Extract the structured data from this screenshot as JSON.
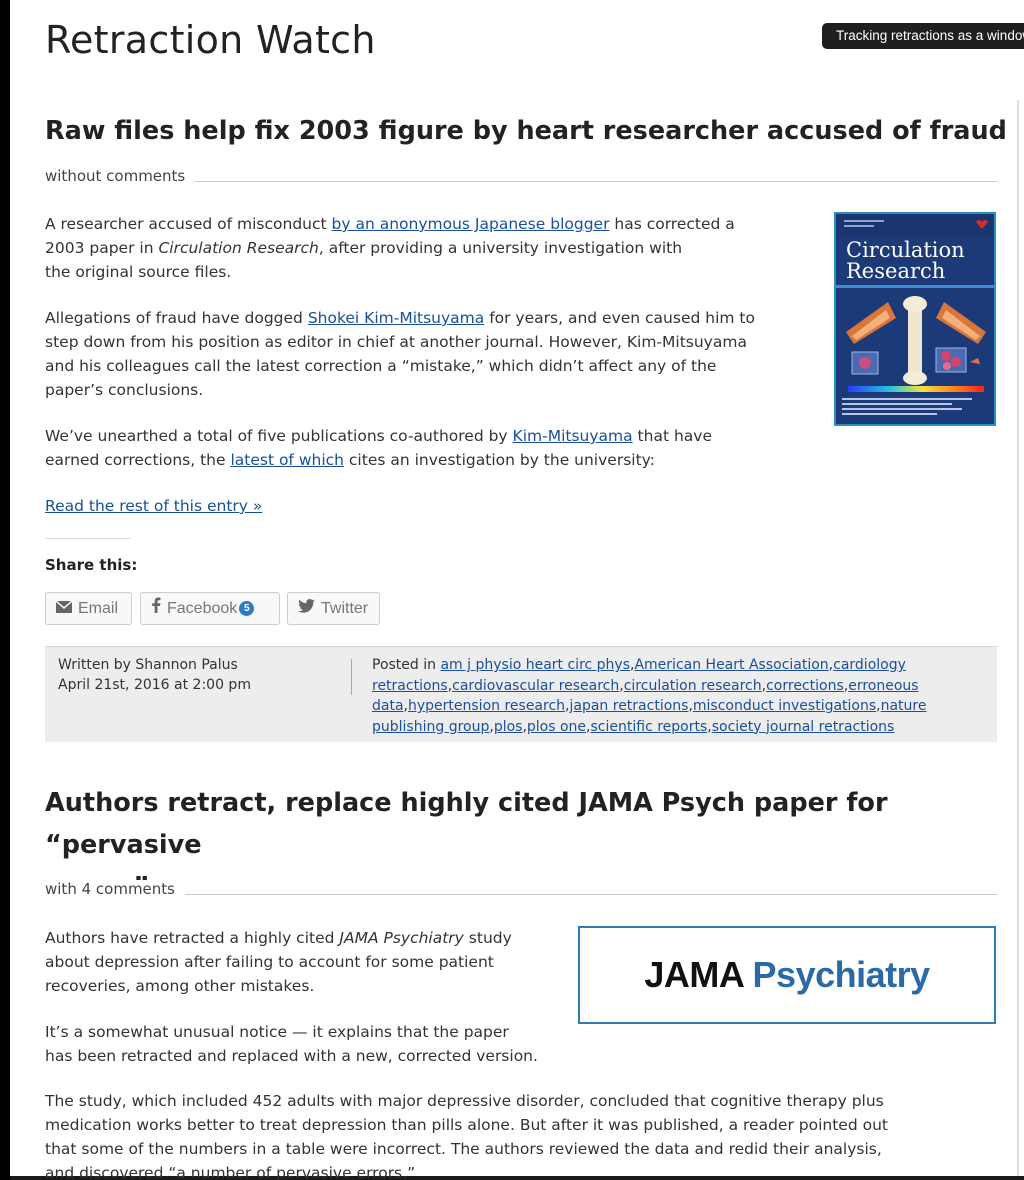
{
  "site": {
    "title": "Retraction Watch",
    "tagline": "Tracking retractions as a window into the scientific process"
  },
  "post1": {
    "title": "Raw files help fix 2003 figure by heart researcher accused of fraud",
    "comments": "without comments",
    "p1": {
      "t1": "A researcher accused of misconduct ",
      "link1": "by an anonymous Japanese blogger",
      "t2": " has corrected a",
      "t3": "2003 paper in ",
      "journal": "Circulation Research",
      "t4": ", after providing a university investigation with",
      "t5": "the original source files."
    },
    "p2": {
      "t1": "Allegations of fraud have dogged ",
      "link1": "Shokei Kim-Mitsuyama",
      "t2": " for years, and even caused him to",
      "t3": "step down from his position as editor in chief at another journal. However, Kim-Mitsuyama",
      "t4": "and his colleagues call the latest correction a “mistake,” which didn’t affect any of the",
      "t5": "paper’s conclusions."
    },
    "p3": {
      "t1": "We’ve unearthed a total of five publications co-authored by ",
      "link1": "Kim-Mitsuyama",
      "t2": " that have",
      "t3": "earned corrections, the ",
      "link2": "latest of which",
      "t4": " cites an investigation by the university:"
    },
    "read_more": "Read the rest of this entry »",
    "cover": {
      "journal_line1": "Circulation",
      "journal_line2": "Research"
    },
    "share": {
      "title": "Share this:",
      "email": "Email",
      "facebook": "Facebook",
      "facebook_count": "5",
      "twitter": "Twitter"
    },
    "info": {
      "written_by": "Written by Shannon Palus",
      "date": "April 21st, 2016 at 2:00 pm",
      "posted_in": "Posted in",
      "tags": [
        "am j physio heart circ phys",
        "American Heart Association",
        "cardiology retractions",
        "cardiovascular research",
        "circulation research",
        "corrections",
        "erroneous data",
        "hypertension research",
        "japan retractions",
        "misconduct investigations",
        "nature publishing group",
        "plos",
        "plos one",
        "scientific reports",
        "society journal retractions"
      ]
    }
  },
  "post2": {
    "title_line1": "Authors retract, replace highly cited JAMA Psych paper for “pervasive",
    "title_line2": "errors”",
    "comments": "with 4 comments",
    "p1": {
      "t1": "Authors have retracted a highly cited ",
      "journal": "JAMA Psychiatry",
      "t2": " study",
      "t3": "about depression after failing to account for some patient",
      "t4": "recoveries, among other mistakes."
    },
    "p2": {
      "t1": "It’s a somewhat unusual notice — it explains that the paper",
      "t2": "has been retracted and replaced with a new, corrected version."
    },
    "p3": {
      "t1": "The study, which included 452 adults with major depressive disorder, concluded that cognitive therapy plus",
      "t2": "medication works better to treat depression than pills alone. But after it was published, a reader pointed out",
      "t3": "that some of the numbers in a table were incorrect. The authors reviewed the data and redid their analysis,",
      "t4": "and discovered “a number of pervasive errors.”"
    },
    "logo": {
      "part1": "JAMA",
      "part2": "Psychiatry"
    }
  }
}
